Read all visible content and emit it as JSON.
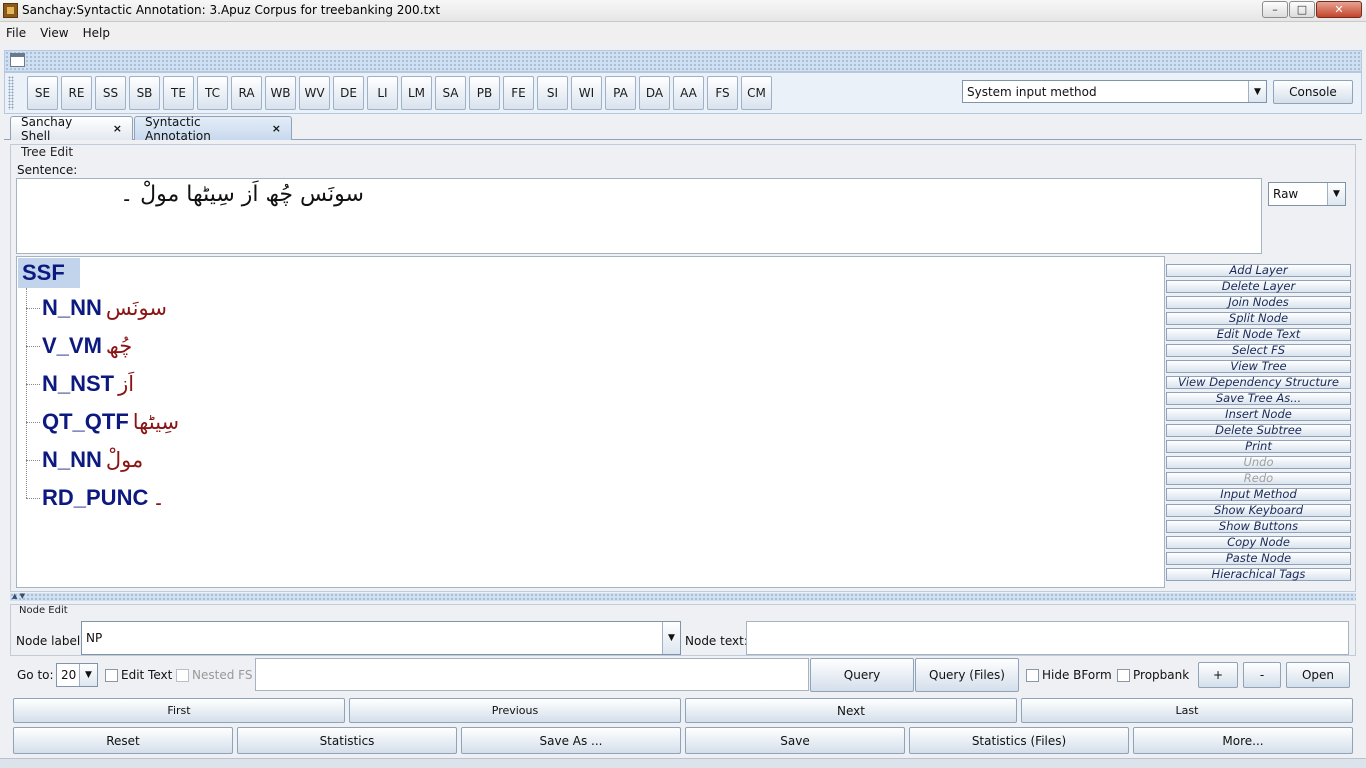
{
  "window": {
    "title": "Sanchay:Syntactic Annotation: 3.Apuz Corpus for treebanking 200.txt",
    "min": "–",
    "max": "□",
    "close": "✕"
  },
  "menu": [
    "File",
    "View",
    "Help"
  ],
  "toolbar": {
    "buttons": [
      "SE",
      "RE",
      "SS",
      "SB",
      "TE",
      "TC",
      "RA",
      "WB",
      "WV",
      "DE",
      "LI",
      "LM",
      "SA",
      "PB",
      "FE",
      "SI",
      "WI",
      "PA",
      "DA",
      "AA",
      "FS",
      "CM"
    ],
    "input_method": "System input method",
    "console": "Console"
  },
  "tabs": [
    {
      "label": "Sanchay Shell",
      "close": "×"
    },
    {
      "label": "Syntactic Annotation",
      "close": "×"
    }
  ],
  "tree_edit": {
    "title": "Tree Edit",
    "sentence_label": "Sentence:",
    "sentence": "سونَس چُھ اَز سِیٹھا مولْ ۔",
    "format": "Raw",
    "root": "SSF",
    "nodes": [
      {
        "tag": "N_NN",
        "word": "سونَس"
      },
      {
        "tag": "V_VM",
        "word": "چُھ"
      },
      {
        "tag": "N_NST",
        "word": "اَز"
      },
      {
        "tag": "QT_QTF",
        "word": "سِیٹھا"
      },
      {
        "tag": "N_NN",
        "word": "مولْ"
      },
      {
        "tag": "RD_PUNC",
        "word": "۔"
      }
    ],
    "side_buttons": [
      "Add Layer",
      "Delete Layer",
      "Join Nodes",
      "Split Node",
      "Edit Node Text",
      "Select FS",
      "View Tree",
      "View Dependency Structure",
      "Save Tree As...",
      "Insert Node",
      "Delete Subtree",
      "Print",
      "Undo",
      "Redo",
      "Input Method",
      "Show Keyboard",
      "Show Buttons",
      "Copy Node",
      "Paste Node",
      "Hierachical Tags"
    ]
  },
  "node_edit": {
    "title": "Node Edit",
    "label_label": "Node label:",
    "label_value": "NP",
    "text_label": "Node text:",
    "text_value": ""
  },
  "query_row": {
    "goto_label": "Go to:",
    "goto_value": "20",
    "edit_text": "Edit Text",
    "nested_fs": "Nested FS",
    "query": "Query",
    "query_files": "Query (Files)",
    "hide_bform": "Hide BForm",
    "propbank": "Propbank",
    "plus": "+",
    "minus": "-",
    "open": "Open"
  },
  "nav": {
    "first": "First",
    "previous": "Previous",
    "next": "Next",
    "last": "Last"
  },
  "bottom": {
    "reset": "Reset",
    "statistics": "Statistics",
    "save_as": "Save As ...",
    "save": "Save",
    "statistics_files": "Statistics (Files)",
    "more": "More..."
  }
}
